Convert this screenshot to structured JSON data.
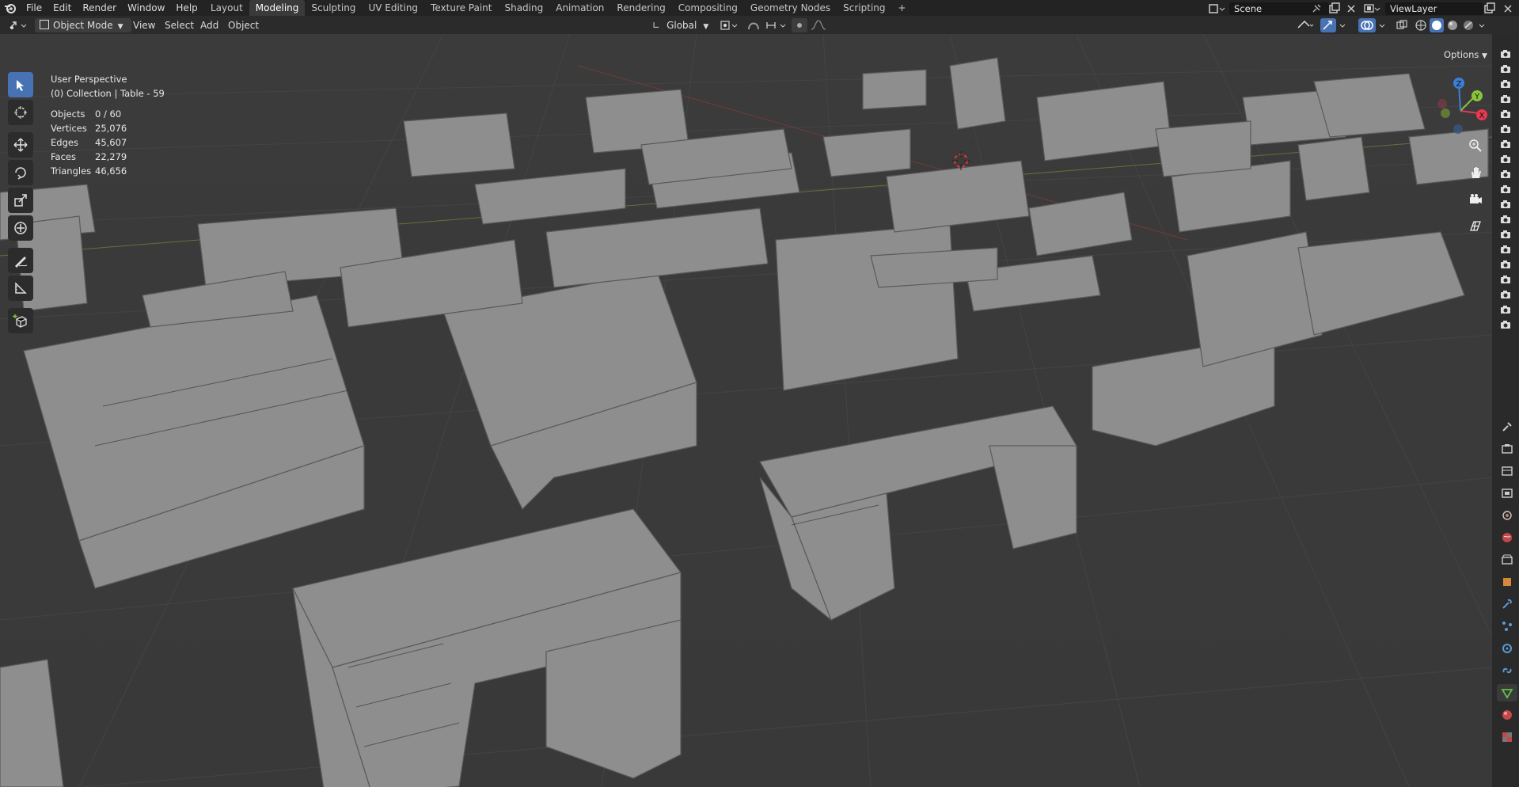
{
  "menus": [
    "File",
    "Edit",
    "Render",
    "Window",
    "Help"
  ],
  "workspace_tabs": [
    {
      "label": "Layout"
    },
    {
      "label": "Modeling",
      "active": true
    },
    {
      "label": "Sculpting"
    },
    {
      "label": "UV Editing"
    },
    {
      "label": "Texture Paint"
    },
    {
      "label": "Shading"
    },
    {
      "label": "Animation"
    },
    {
      "label": "Rendering"
    },
    {
      "label": "Compositing"
    },
    {
      "label": "Geometry Nodes"
    },
    {
      "label": "Scripting"
    }
  ],
  "add_tab_glyph": "+",
  "scene": {
    "label": "Scene"
  },
  "view_layer": {
    "label": "ViewLayer"
  },
  "header": {
    "mode": "Object Mode",
    "view": "View",
    "select": "Select",
    "add": "Add",
    "object": "Object",
    "orientation": "Global",
    "options": "Options"
  },
  "overlay_text": {
    "perspective": "User Perspective",
    "collection": "(0) Collection | Table - 59"
  },
  "stats": [
    {
      "label": "Objects",
      "value": "0 / 60"
    },
    {
      "label": "Vertices",
      "value": "25,076"
    },
    {
      "label": "Edges",
      "value": "45,607"
    },
    {
      "label": "Faces",
      "value": "22,279"
    },
    {
      "label": "Triangles",
      "value": "46,656"
    }
  ],
  "gizmo": {
    "x": "X",
    "y": "Y",
    "z": "Z"
  },
  "colors": {
    "x_axis": "#e8394f",
    "y_axis": "#8ac43a",
    "z_axis": "#3c7fd9",
    "active_tool": "#4772b3"
  },
  "tools": [
    "select-box-icon",
    "cursor-icon",
    "move-icon",
    "rotate-icon",
    "scale-icon",
    "transform-icon",
    "annotate-icon",
    "measure-icon",
    "add-cube-icon"
  ]
}
